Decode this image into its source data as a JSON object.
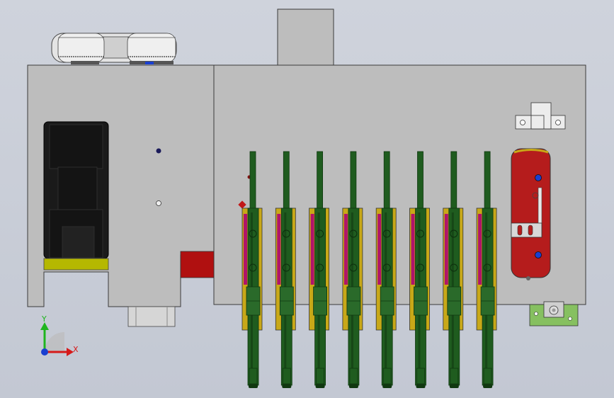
{
  "viewport": {
    "background": "#c9cdd7",
    "view": "Front"
  },
  "colors": {
    "housing": "#bdbdbd",
    "housing_edge": "#3a3a3a",
    "motor_body": "#1a1a1a",
    "motor_band": "#b5b800",
    "shaft_green": "#1f5c1f",
    "shaft_dark": "#103810",
    "clamp_yellow": "#c8a818",
    "clamp_magenta": "#b0146a",
    "cam_plate_red": "#b51c1c",
    "small_block_red": "#b01010",
    "base_bracket_green": "#86c060",
    "pulley_silver": "#e4e4e4",
    "accent_blue": "#1a3fd0",
    "axis_x": "#d61a1a",
    "axis_y": "#1eb51e",
    "axis_z": "#1a3fd0"
  },
  "shaft_units": {
    "count": 8
  },
  "triad": {
    "x_label": "X",
    "y_label": "Y"
  }
}
